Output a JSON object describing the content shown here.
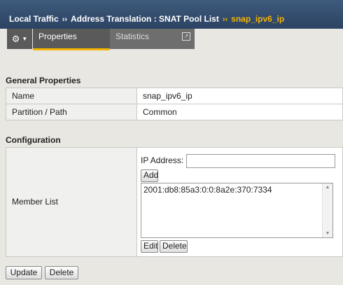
{
  "breadcrumb": {
    "root": "Local Traffic",
    "section": "Address Translation : SNAT Pool List",
    "current": "snap_ipv6_ip",
    "separator": "››"
  },
  "tabs": {
    "menu_icon": "gear-icon",
    "properties": "Properties",
    "statistics": "Statistics"
  },
  "general": {
    "heading": "General Properties",
    "rows": [
      {
        "label": "Name",
        "value": "snap_ipv6_ip"
      },
      {
        "label": "Partition / Path",
        "value": "Common"
      }
    ]
  },
  "configuration": {
    "heading": "Configuration",
    "member_list_label": "Member List",
    "ip_address_label": "IP Address:",
    "ip_address_value": "",
    "add_button": "Add",
    "members": [
      "2001:db8:85a3:0:0:8a2e:370:7334"
    ],
    "edit_button": "Edit",
    "delete_button": "Delete"
  },
  "footer": {
    "update_button": "Update",
    "delete_button": "Delete"
  },
  "colors": {
    "title_bg": "#2c4363",
    "accent": "#f5b400",
    "tab_bg": "#5a5a5a"
  }
}
